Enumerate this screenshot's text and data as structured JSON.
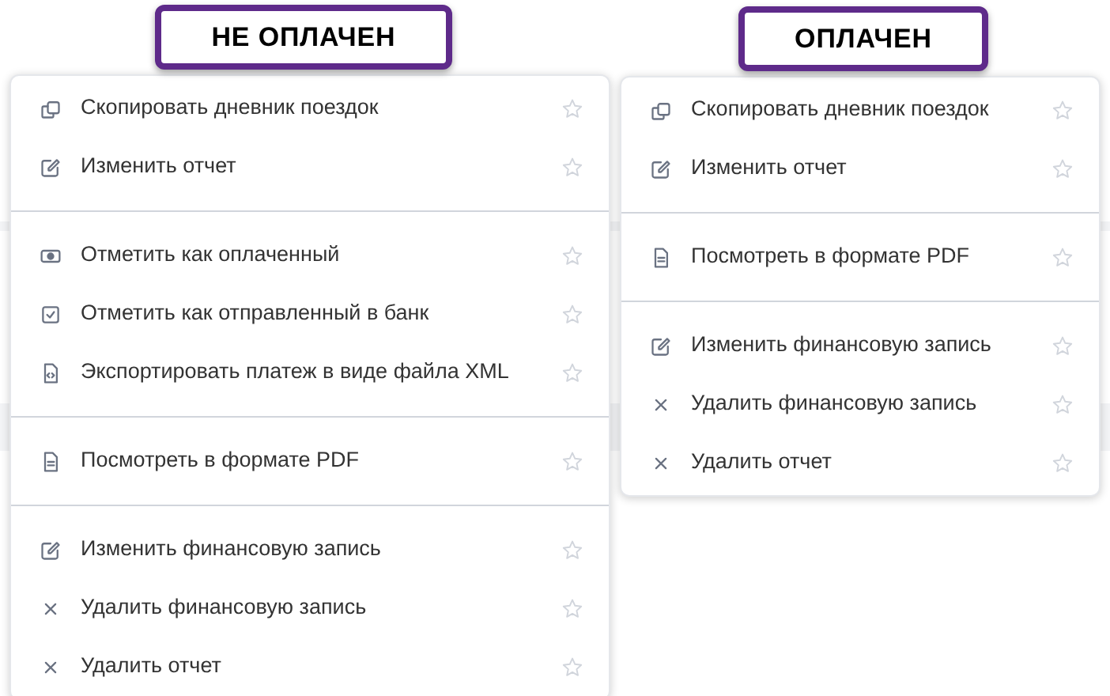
{
  "panels": [
    {
      "label": "НЕ ОПЛАЧЕН",
      "sections": [
        [
          {
            "kind": "copy",
            "text": "Скопировать дневник поездок"
          },
          {
            "kind": "edit",
            "text": "Изменить отчет"
          }
        ],
        [
          {
            "kind": "cash",
            "text": "Отметить как оплаченный"
          },
          {
            "kind": "check",
            "text": "Отметить как отправленный в банк"
          },
          {
            "kind": "code-file",
            "text": "Экспортировать платеж в виде файла XML"
          }
        ],
        [
          {
            "kind": "file",
            "text": "Посмотреть в формате PDF"
          }
        ],
        [
          {
            "kind": "edit",
            "text": "Изменить финансовую запись"
          },
          {
            "kind": "delete",
            "text": "Удалить финансовую запись"
          },
          {
            "kind": "delete",
            "text": "Удалить отчет"
          }
        ]
      ]
    },
    {
      "label": "ОПЛАЧЕН",
      "sections": [
        [
          {
            "kind": "copy",
            "text": "Скопировать дневник поездок"
          },
          {
            "kind": "edit",
            "text": "Изменить отчет"
          }
        ],
        [
          {
            "kind": "file",
            "text": "Посмотреть в формате PDF"
          }
        ],
        [
          {
            "kind": "edit",
            "text": "Изменить финансовую запись"
          },
          {
            "kind": "delete",
            "text": "Удалить финансовую запись"
          },
          {
            "kind": "delete",
            "text": "Удалить отчет"
          }
        ]
      ]
    }
  ]
}
